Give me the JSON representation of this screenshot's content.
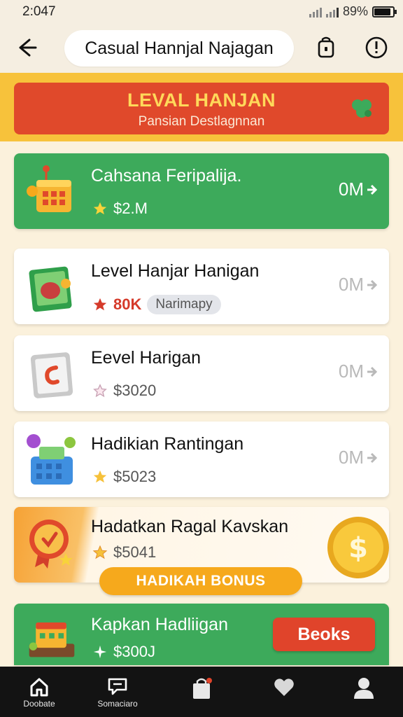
{
  "status_bar": {
    "time": "2:047",
    "battery": "89%"
  },
  "header": {
    "title": "Casual Hannjal Najagan"
  },
  "banner": {
    "title": "LEVAL HANJAN",
    "subtitle": "Pansian Destlagnnan"
  },
  "items": [
    {
      "name": "Cahsana Feripalija.",
      "price": "$2.M",
      "action": "0M"
    },
    {
      "name": "Level Hanjar Hanigan",
      "price": "80K",
      "tag": "Narimapy",
      "action": "0M"
    },
    {
      "name": "Eevel Harigan",
      "price": "$3020",
      "action": "0M"
    },
    {
      "name": "Hadikian Rantingan",
      "price": "$5023",
      "action": "0M"
    },
    {
      "name": "Hadatkan Ragal Kavskan",
      "price": "$5041",
      "bonus": "HADIKAH BONUS"
    },
    {
      "name": "Kapkan Hadliigan",
      "price": "$300J",
      "button": "Beoks"
    }
  ],
  "nav": [
    {
      "label": "Doobate",
      "icon": "home-icon"
    },
    {
      "label": "Somaciaro",
      "icon": "chat-icon"
    },
    {
      "label": "",
      "icon": "bag-icon"
    },
    {
      "label": "",
      "icon": "heart-icon"
    },
    {
      "label": "",
      "icon": "profile-icon"
    }
  ],
  "colors": {
    "green": "#3daa5b",
    "red": "#e0492b",
    "yellow": "#f7c23b",
    "orange": "#f6a91c"
  }
}
